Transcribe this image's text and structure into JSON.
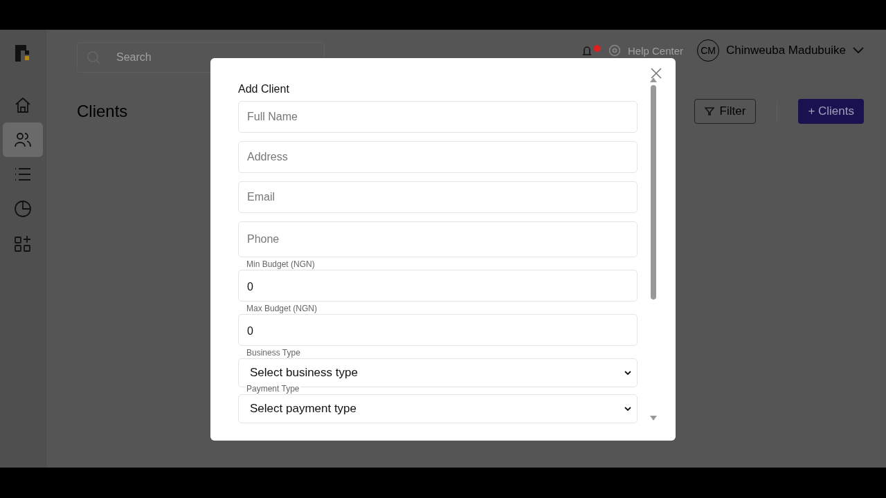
{
  "sidebar": {
    "items": [
      {
        "selected": false
      },
      {
        "selected": true
      },
      {
        "selected": false
      },
      {
        "selected": false
      },
      {
        "selected": false
      }
    ]
  },
  "header": {
    "search": {
      "placeholder": "Search"
    },
    "notifications": {
      "unread": true
    },
    "help": "Help Center",
    "user": {
      "initials": "CM",
      "name": "Chinweuba Madubuike"
    }
  },
  "page": {
    "title": "Clients",
    "filter_button": "Filter",
    "add_button": "+ Clients"
  },
  "modal": {
    "title": "Add Client",
    "fields": [
      {
        "kind": "text",
        "placeholder": "Full Name"
      },
      {
        "kind": "text",
        "placeholder": "Address"
      },
      {
        "kind": "text",
        "placeholder": "Email"
      },
      {
        "kind": "text",
        "placeholder": "Phone"
      },
      {
        "kind": "number",
        "label": "Min Budget (NGN)",
        "value": "0"
      },
      {
        "kind": "number",
        "label": "Max Budget (NGN)",
        "value": "0"
      },
      {
        "kind": "select",
        "label": "Business Type",
        "value": "Select business type"
      },
      {
        "kind": "select",
        "label": "Payment Type",
        "value": "Select payment type"
      }
    ]
  }
}
